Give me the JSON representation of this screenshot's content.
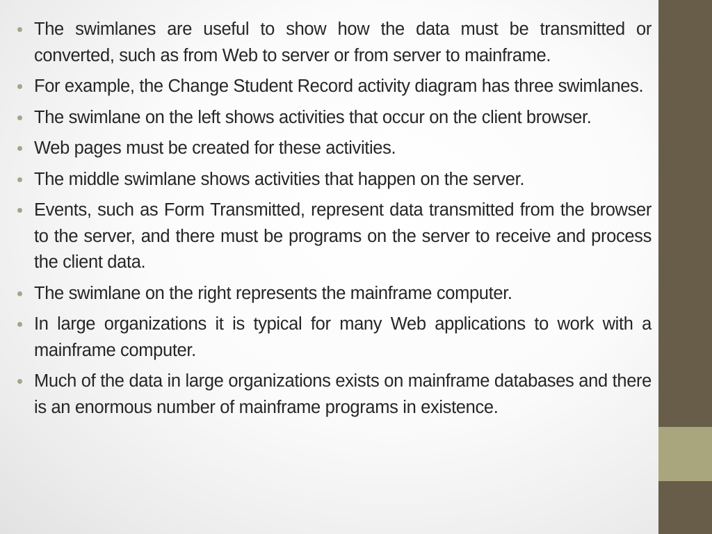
{
  "slide": {
    "bullets": [
      "The swimlanes are useful to show how the data must be transmitted or converted, such as from Web to server or from server to mainframe.",
      "For example, the Change Student Record activity diagram has three swimlanes.",
      "The swimlane on the left shows activities that occur on the client browser.",
      "Web pages must be created for these activities.",
      "The middle swimlane shows activities that happen on the server.",
      "Events, such as Form Transmitted, represent data transmitted from the browser to the server, and there must be programs on the server to receive and process the client data.",
      "The swimlane on the right represents the mainframe computer.",
      "In large organizations it is typical for many Web applications to work with a mainframe computer.",
      "Much of the data in large organizations exists on mainframe databases and there is an enormous number of mainframe programs in existence."
    ]
  },
  "theme": {
    "sidebar_color": "#675d48",
    "sidebar_band_color": "#a9a57d",
    "bullet_color": "#a3a78a",
    "text_color": "#262626"
  }
}
